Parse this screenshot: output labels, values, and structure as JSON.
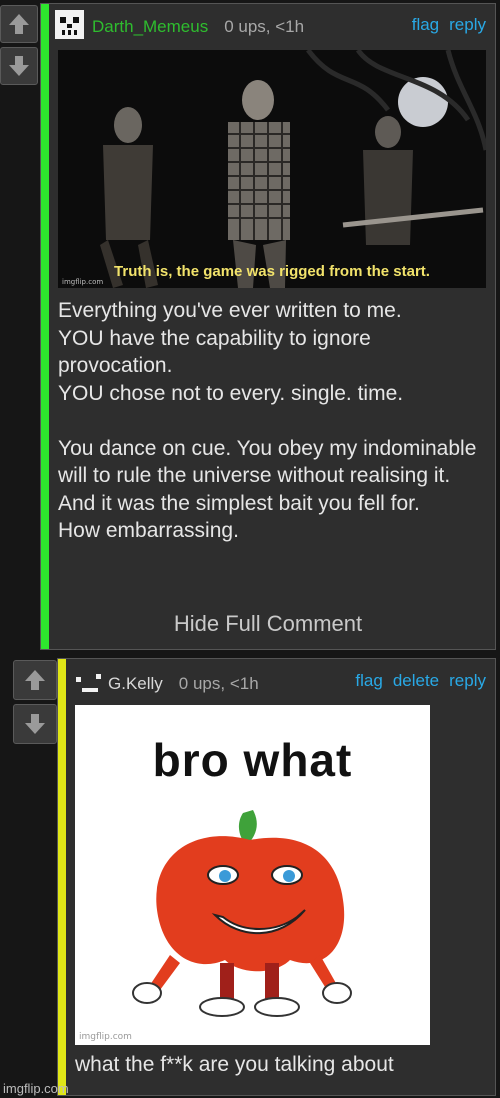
{
  "colors": {
    "accent_green": "#2ee62e",
    "accent_yellow": "#e0e617",
    "link_blue": "#29a9e6",
    "username_green": "#2ebd2e"
  },
  "icons": {
    "upvote": "arrow-up-icon",
    "downvote": "arrow-down-icon"
  },
  "comment1": {
    "username": "Darth_Memeus",
    "meta": "0 ups, <1h",
    "actions": [
      "flag",
      "reply"
    ],
    "meme_caption": "Truth is, the game was rigged from the start.",
    "meme_watermark": "imgflip.com",
    "body": "Everything you've ever written to me.\nYOU have the capability to ignore provocation.\nYOU chose not to every. single. time.\n\nYou dance on cue. You obey my indominable will to rule the universe without realising it.\nAnd it was the simplest bait you fell for.\nHow embarrassing.",
    "hide_label": "Hide Full Comment"
  },
  "comment2": {
    "username": "G.Kelly",
    "meta": "0 ups, <1h",
    "actions": [
      "flag",
      "delete",
      "reply"
    ],
    "meme_title": "bro what",
    "meme_watermark": "imgflip.com",
    "body": "what the f**k are you talking about"
  },
  "page_watermark": "imgflip.com"
}
